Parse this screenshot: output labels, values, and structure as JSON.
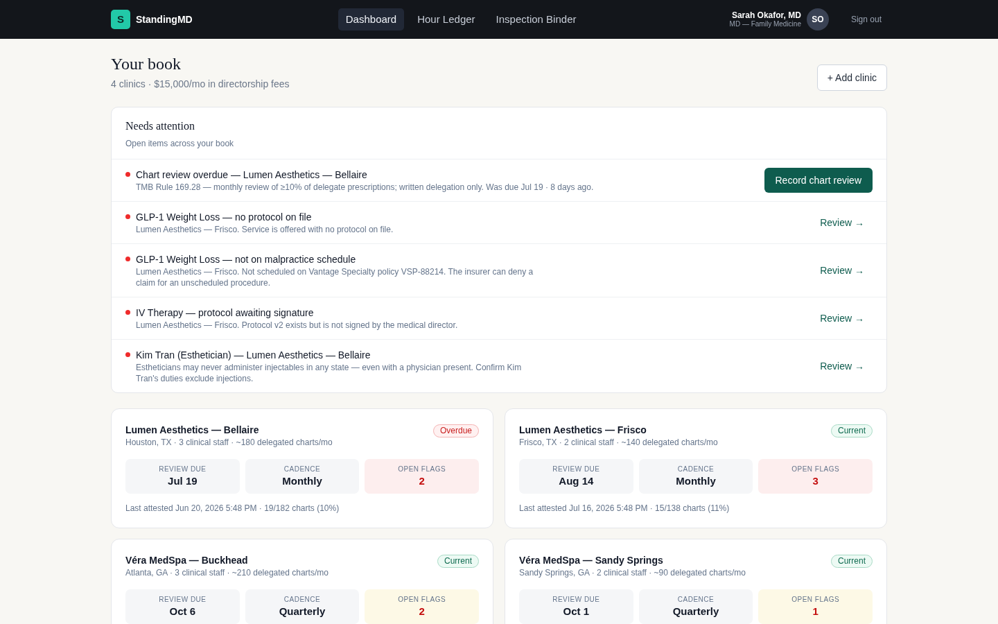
{
  "navbar": {
    "brand": {
      "mark": "S",
      "name": "StandingMD"
    },
    "links": [
      {
        "label": "Dashboard",
        "selected": true
      },
      {
        "label": "Hour Ledger",
        "selected": false
      },
      {
        "label": "Inspection Binder",
        "selected": false
      }
    ],
    "user": {
      "name": "Sarah Okafor, MD",
      "role": "MD — Family Medicine",
      "initials": "SO"
    },
    "sign_out": "Sign out"
  },
  "page": {
    "title": "Your book",
    "subtitle": "4 clinics · $15,000/mo in directorship fees",
    "add_button": "+ Add clinic"
  },
  "attention": {
    "title": "Needs attention",
    "subtitle": "Open items across your book",
    "items": [
      {
        "title": "Chart review overdue — Lumen Aesthetics — Bellaire",
        "detail": "TMB Rule 169.28 — monthly review of ≥10% of delegate prescriptions; written delegation only. Was due Jul 19 · 8 days ago.",
        "action": {
          "kind": "button",
          "label": "Record chart review"
        }
      },
      {
        "title": "GLP-1 Weight Loss — no protocol on file",
        "detail": "Lumen Aesthetics — Frisco. Service is offered with no protocol on file.",
        "action": {
          "kind": "link",
          "label": "Review →"
        }
      },
      {
        "title": "GLP-1 Weight Loss — not on malpractice schedule",
        "detail": "Lumen Aesthetics — Frisco. Not scheduled on Vantage Specialty policy VSP-88214. The insurer can deny a claim for an unscheduled procedure.",
        "action": {
          "kind": "link",
          "label": "Review →"
        }
      },
      {
        "title": "IV Therapy — protocol awaiting signature",
        "detail": "Lumen Aesthetics — Frisco. Protocol v2 exists but is not signed by the medical director.",
        "action": {
          "kind": "link",
          "label": "Review →"
        }
      },
      {
        "title": "Kim Tran (Esthetician) — Lumen Aesthetics — Bellaire",
        "detail": "Estheticians may never administer injectables in any state — even with a physician present. Confirm Kim Tran's duties exclude injections.",
        "action": {
          "kind": "link",
          "label": "Review →"
        }
      }
    ]
  },
  "clinics": [
    {
      "name": "Lumen Aesthetics — Bellaire",
      "location": "Houston, TX · 3 clinical staff · ~180 delegated charts/mo",
      "status": {
        "kind": "overdue",
        "label": "Overdue"
      },
      "stats": [
        {
          "kind": "neutral",
          "label": "REVIEW DUE",
          "value": "Jul 19"
        },
        {
          "kind": "neutral",
          "label": "CADENCE",
          "value": "Monthly"
        },
        {
          "kind": "danger",
          "label": "OPEN FLAGS",
          "value": "2"
        }
      ],
      "footer": "Last attested Jun 20, 2026 5:48 PM · 19/182 charts (10%)"
    },
    {
      "name": "Lumen Aesthetics — Frisco",
      "location": "Frisco, TX · 2 clinical staff · ~140 delegated charts/mo",
      "status": {
        "kind": "current",
        "label": "Current"
      },
      "stats": [
        {
          "kind": "neutral",
          "label": "REVIEW DUE",
          "value": "Aug 14"
        },
        {
          "kind": "neutral",
          "label": "CADENCE",
          "value": "Monthly"
        },
        {
          "kind": "danger",
          "label": "OPEN FLAGS",
          "value": "3"
        }
      ],
      "footer": "Last attested Jul 16, 2026 5:48 PM · 15/138 charts (11%)"
    },
    {
      "name": "Véra MedSpa — Buckhead",
      "location": "Atlanta, GA · 3 clinical staff · ~210 delegated charts/mo",
      "status": {
        "kind": "current",
        "label": "Current"
      },
      "stats": [
        {
          "kind": "neutral",
          "label": "REVIEW DUE",
          "value": "Oct 6"
        },
        {
          "kind": "neutral",
          "label": "CADENCE",
          "value": "Quarterly"
        },
        {
          "kind": "warning",
          "label": "OPEN FLAGS",
          "value": "2"
        }
      ]
    },
    {
      "name": "Véra MedSpa — Sandy Springs",
      "location": "Sandy Springs, GA · 2 clinical staff · ~90 delegated charts/mo",
      "status": {
        "kind": "current",
        "label": "Current"
      },
      "stats": [
        {
          "kind": "neutral",
          "label": "REVIEW DUE",
          "value": "Oct 1"
        },
        {
          "kind": "neutral",
          "label": "CADENCE",
          "value": "Quarterly"
        },
        {
          "kind": "warning",
          "label": "OPEN FLAGS",
          "value": "1"
        }
      ]
    }
  ]
}
